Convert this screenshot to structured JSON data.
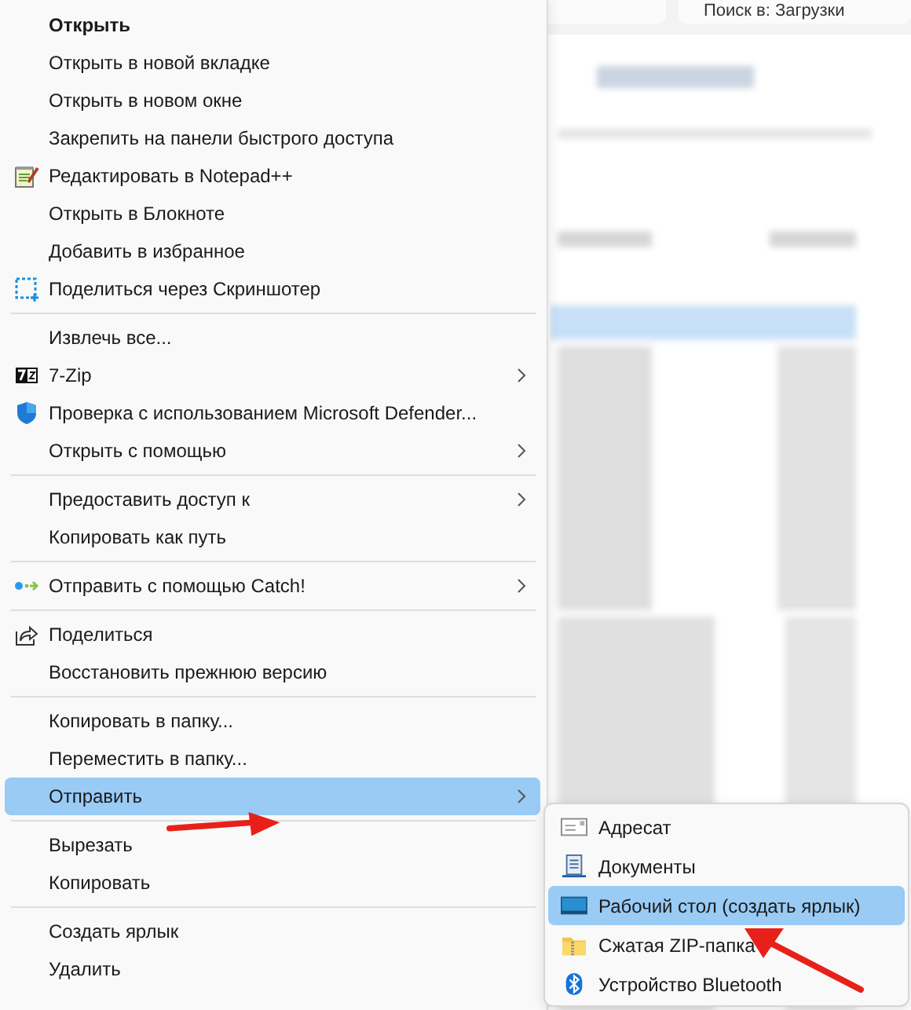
{
  "search": {
    "placeholder": "Поиск в: Загрузки"
  },
  "context_menu": {
    "groups": [
      [
        {
          "label": "Открыть",
          "default": true,
          "selected": false,
          "submenu": false
        },
        {
          "label": "Открыть в новой вкладке",
          "default": false,
          "selected": false,
          "submenu": false
        },
        {
          "label": "Открыть в новом окне",
          "default": false,
          "selected": false,
          "submenu": false
        },
        {
          "label": "Закрепить на панели быстрого доступа",
          "default": false,
          "selected": false,
          "submenu": false
        },
        {
          "label": "Редактировать в Notepad++",
          "default": false,
          "selected": false,
          "submenu": false
        },
        {
          "label": "Открыть в Блокноте",
          "default": false,
          "selected": false,
          "submenu": false
        },
        {
          "label": "Добавить в избранное",
          "default": false,
          "selected": false,
          "submenu": false
        },
        {
          "label": "Поделиться через Скриншотер",
          "default": false,
          "selected": false,
          "submenu": false
        }
      ],
      [
        {
          "label": "Извлечь все...",
          "default": false,
          "selected": false,
          "submenu": false
        },
        {
          "label": "7-Zip",
          "default": false,
          "selected": false,
          "submenu": true
        },
        {
          "label": "Проверка с использованием Microsoft Defender...",
          "default": false,
          "selected": false,
          "submenu": false
        },
        {
          "label": "Открыть с помощью",
          "default": false,
          "selected": false,
          "submenu": true
        }
      ],
      [
        {
          "label": "Предоставить доступ к",
          "default": false,
          "selected": false,
          "submenu": true
        },
        {
          "label": "Копировать как путь",
          "default": false,
          "selected": false,
          "submenu": false
        }
      ],
      [
        {
          "label": "Отправить с помощью Catch!",
          "default": false,
          "selected": false,
          "submenu": true
        }
      ],
      [
        {
          "label": "Поделиться",
          "default": false,
          "selected": false,
          "submenu": false
        },
        {
          "label": "Восстановить прежнюю версию",
          "default": false,
          "selected": false,
          "submenu": false
        }
      ],
      [
        {
          "label": "Копировать в папку...",
          "default": false,
          "selected": false,
          "submenu": false
        },
        {
          "label": "Переместить в папку...",
          "default": false,
          "selected": false,
          "submenu": false
        },
        {
          "label": "Отправить",
          "default": false,
          "selected": true,
          "submenu": true
        }
      ],
      [
        {
          "label": "Вырезать",
          "default": false,
          "selected": false,
          "submenu": false
        },
        {
          "label": "Копировать",
          "default": false,
          "selected": false,
          "submenu": false
        }
      ],
      [
        {
          "label": "Создать ярлык",
          "default": false,
          "selected": false,
          "submenu": false
        },
        {
          "label": "Удалить",
          "default": false,
          "selected": false,
          "submenu": false
        }
      ]
    ]
  },
  "send_to_menu": {
    "items": [
      {
        "label": "Адресат",
        "selected": false
      },
      {
        "label": "Документы",
        "selected": false
      },
      {
        "label": "Рабочий стол (создать ярлык)",
        "selected": true
      },
      {
        "label": "Сжатая ZIP-папка",
        "selected": false
      },
      {
        "label": "Устройство Bluetooth",
        "selected": false
      }
    ]
  }
}
